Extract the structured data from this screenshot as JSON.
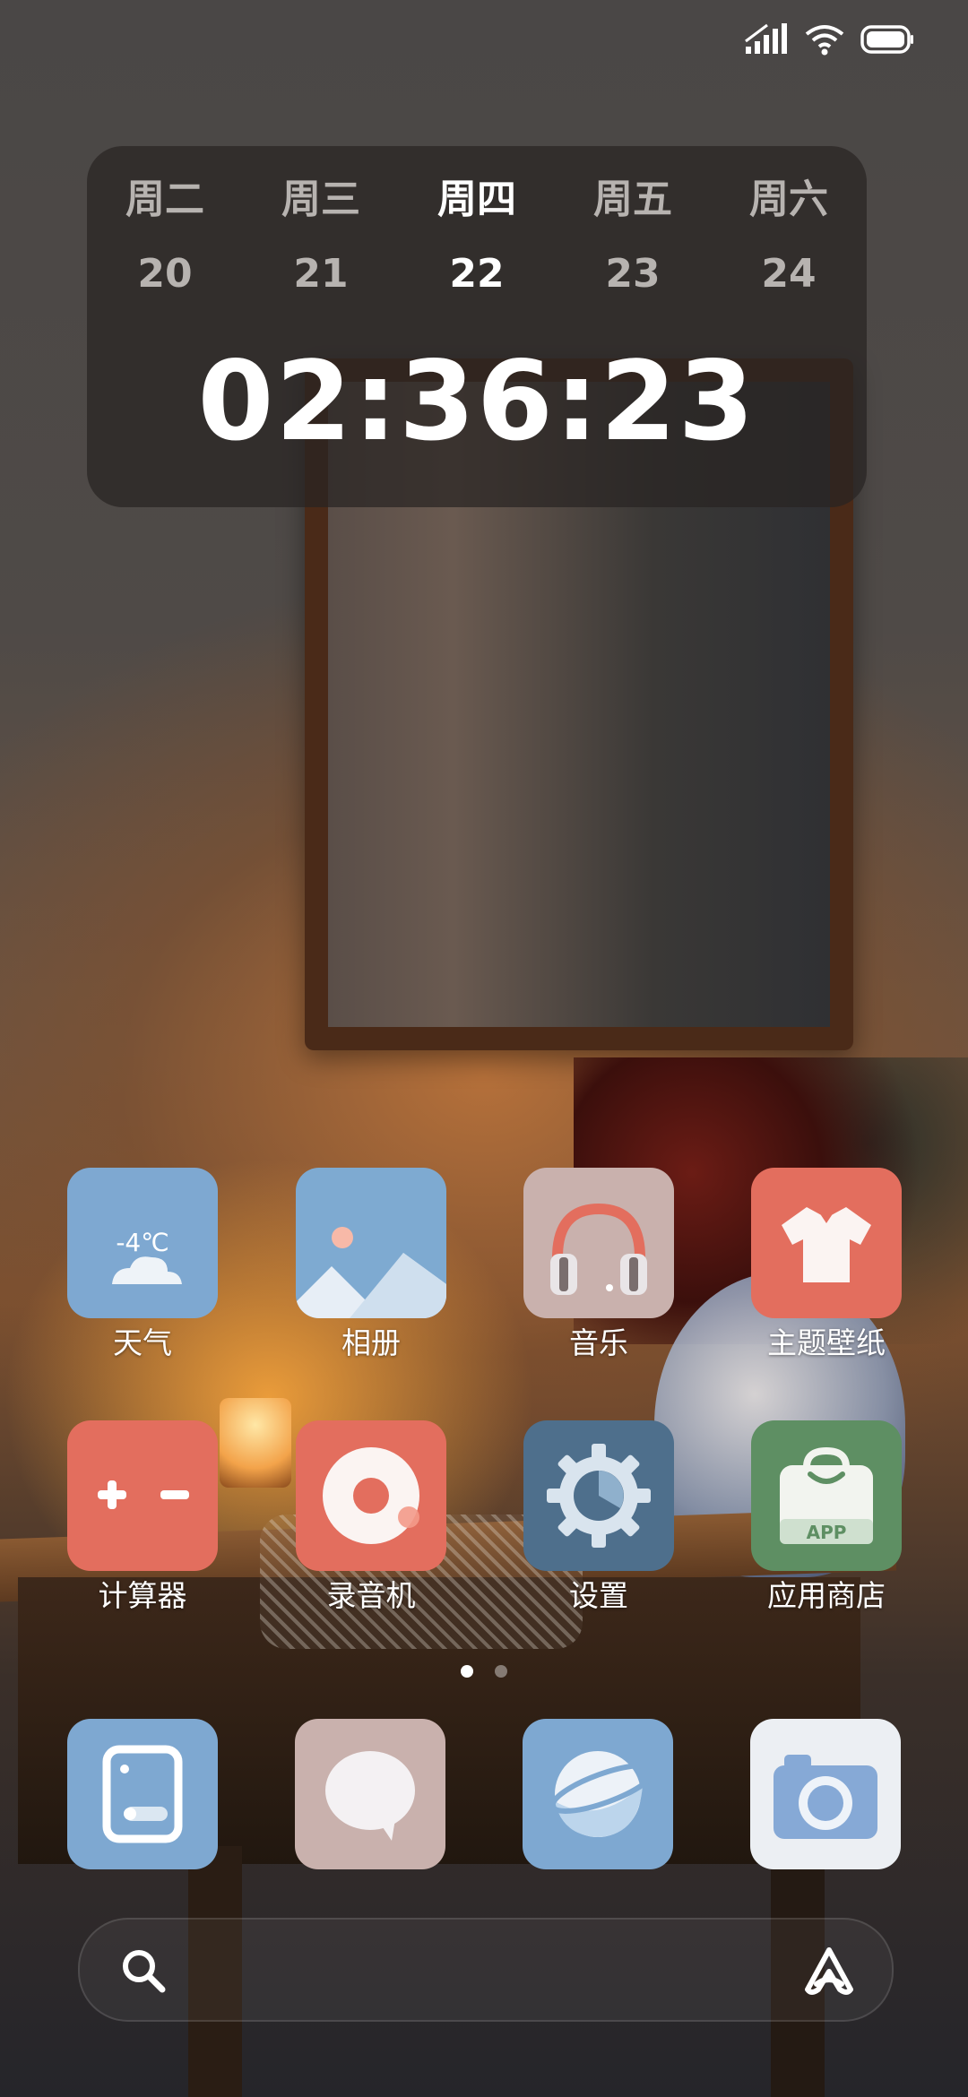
{
  "status_bar": {
    "icons": [
      "signal-icon",
      "wifi-icon",
      "battery-icon"
    ]
  },
  "widget": {
    "days": [
      {
        "name": "周二",
        "date": "20",
        "active": false
      },
      {
        "name": "周三",
        "date": "21",
        "active": false
      },
      {
        "name": "周四",
        "date": "22",
        "active": true
      },
      {
        "name": "周五",
        "date": "23",
        "active": false
      },
      {
        "name": "周六",
        "date": "24",
        "active": false
      }
    ],
    "time": "02:36:23"
  },
  "apps": {
    "weather": {
      "label": "天气",
      "temp": "-4℃",
      "color": "#7ea8d1"
    },
    "gallery": {
      "label": "相册",
      "color": "#7eaad1"
    },
    "music": {
      "label": "音乐",
      "color": "#c9b1ad"
    },
    "theme": {
      "label": "主题壁纸",
      "color": "#e36e5e"
    },
    "calculator": {
      "label": "计算器",
      "color": "#e36e5e"
    },
    "recorder": {
      "label": "录音机",
      "color": "#e36e5e"
    },
    "settings": {
      "label": "设置",
      "color": "#4e6f8c"
    },
    "appstore": {
      "label": "应用商店",
      "badge": "APP",
      "color": "#5e8f63"
    }
  },
  "page_indicator": {
    "pages": 2,
    "current": 1
  },
  "dock": [
    {
      "icon": "phone-icon",
      "color": "#7ea8d1"
    },
    {
      "icon": "message-icon",
      "color": "#c9b1ad"
    },
    {
      "icon": "browser-icon",
      "color": "#7ea8d1"
    },
    {
      "icon": "camera-icon",
      "color": "#eceff3"
    }
  ],
  "search_bar": {
    "left_icon": "search-icon",
    "right_icon": "assistant-icon"
  }
}
